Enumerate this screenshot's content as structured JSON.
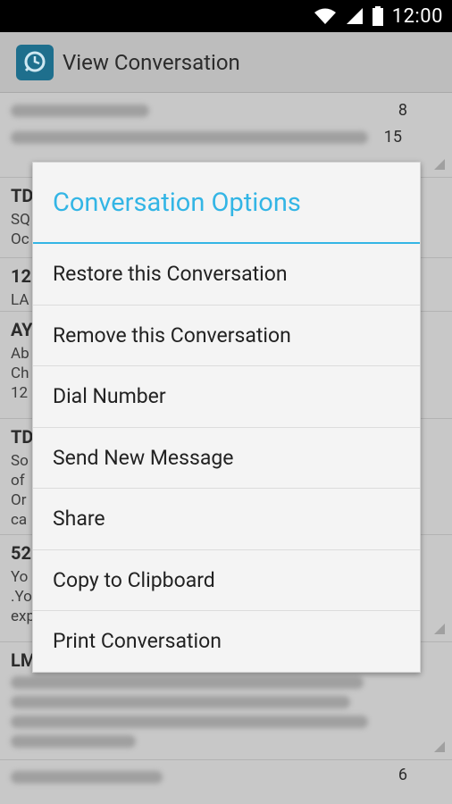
{
  "status_bar": {
    "time": "12:00"
  },
  "action_bar": {
    "title": "View Conversation"
  },
  "list": {
    "rows": [
      {
        "name": "",
        "count": "8",
        "count2": "15",
        "preview": ""
      },
      {
        "name": "TD",
        "count": "",
        "preview_lines": [
          "SQ",
          "Oc"
        ]
      },
      {
        "name": "12",
        "count": "",
        "preview_lines": [
          "LA"
        ]
      },
      {
        "name": "AY",
        "count": "",
        "preview_lines": [
          "Ab",
          "Ch",
          "12"
        ]
      },
      {
        "name": "TD",
        "count": "",
        "preview_lines": [
          "So",
          "of",
          "Or",
          "ca"
        ]
      },
      {
        "name": "52",
        "count": "",
        "preview_lines": [
          "Yo",
          ".Yo",
          "exp"
        ]
      },
      {
        "name": "LM",
        "count": "",
        "preview_lines": []
      },
      {
        "name": "",
        "count": "6",
        "preview_lines": []
      }
    ]
  },
  "dialog": {
    "title": "Conversation Options",
    "options": [
      "Restore this Conversation",
      "Remove this Conversation",
      "Dial Number",
      "Send New Message",
      "Share",
      "Copy to Clipboard",
      "Print Conversation"
    ]
  }
}
